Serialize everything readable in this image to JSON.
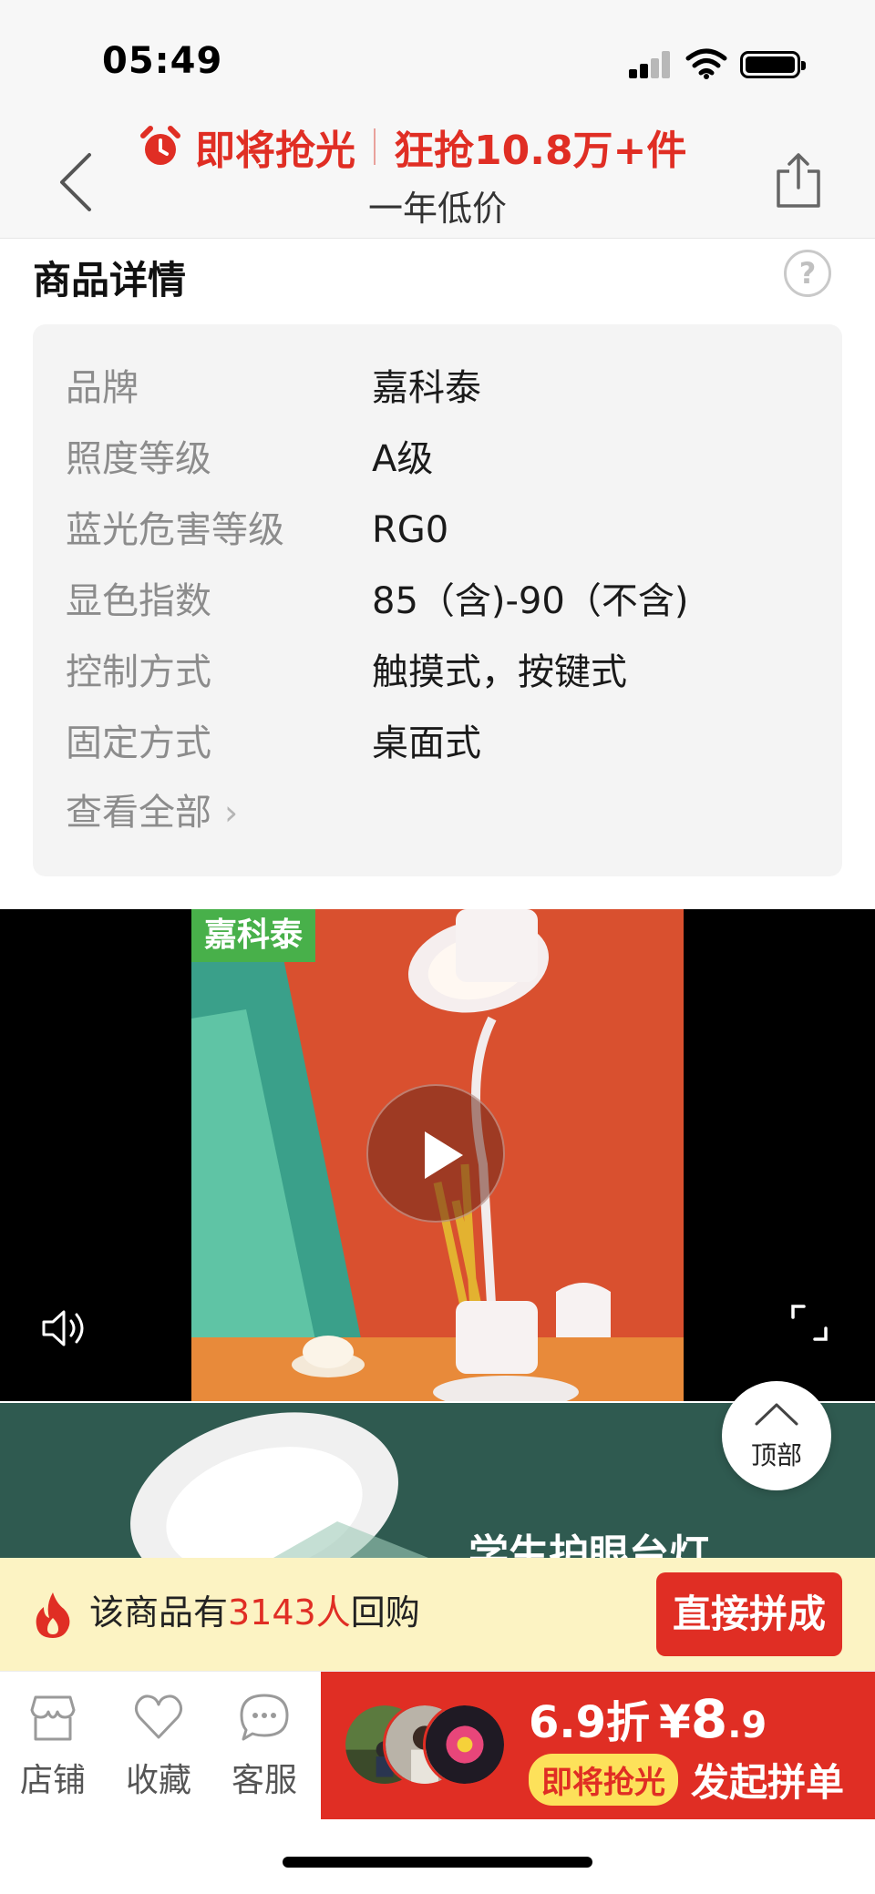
{
  "status_bar": {
    "time": "05:49"
  },
  "header": {
    "promo_soon": "即将抢光",
    "promo_sold": "狂抢10.8万+件",
    "subtitle": "一年低价"
  },
  "detail": {
    "title": "商品详情",
    "help": "?",
    "specs": [
      {
        "label": "品牌",
        "value": "嘉科泰"
      },
      {
        "label": "照度等级",
        "value": "A级"
      },
      {
        "label": "蓝光危害等级",
        "value": "RG0"
      },
      {
        "label": "显色指数",
        "value": "85（含)-90（不含)"
      },
      {
        "label": "控制方式",
        "value": "触摸式，按键式"
      },
      {
        "label": "固定方式",
        "value": "桌面式"
      }
    ],
    "view_all": "查看全部",
    "view_all_chevron": "›"
  },
  "video": {
    "brand_tag": "嘉科泰"
  },
  "second_image": {
    "banner_text": "学生护眼台灯"
  },
  "top_button": {
    "label": "顶部"
  },
  "repurchase": {
    "prefix": "该商品有",
    "count": "3143人",
    "suffix": "回购",
    "button": "直接拼成"
  },
  "bottom_bar": {
    "store": "店铺",
    "favorite": "收藏",
    "service": "客服",
    "discount": "6.9折",
    "price_symbol": "¥",
    "price_int": "8",
    "price_dec": ".9",
    "soon_badge": "即将抢光",
    "cta": "发起拼单"
  },
  "colors": {
    "accent": "#e02e24",
    "repurchase_bg": "#fcf3c3",
    "badge": "#fde15a"
  }
}
